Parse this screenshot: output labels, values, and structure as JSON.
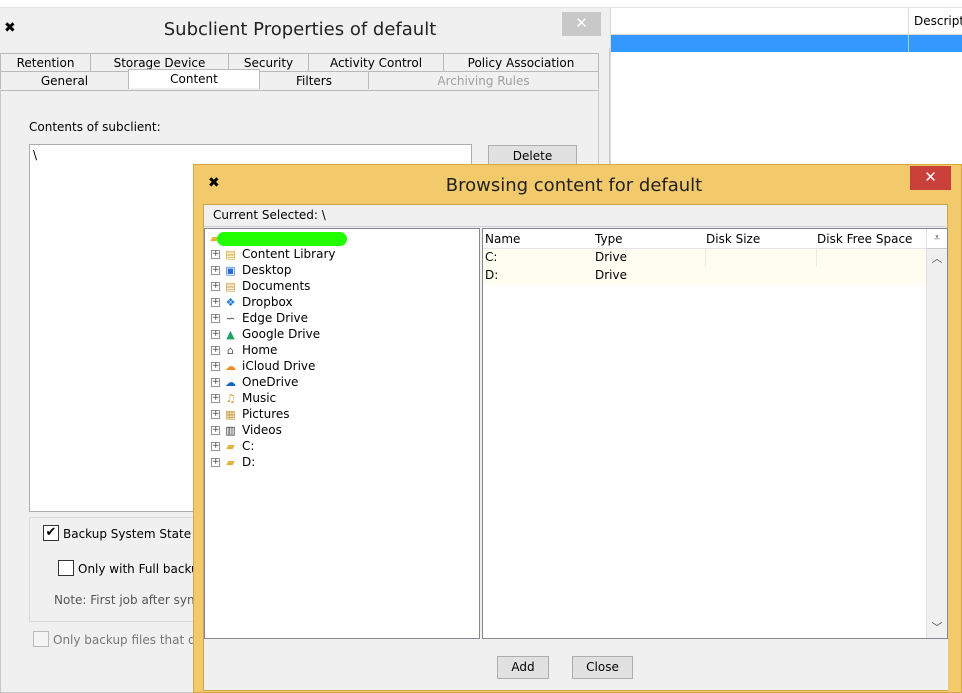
{
  "background_window": {
    "column_header": "Descripti"
  },
  "subclient_dialog": {
    "title": "Subclient Properties of default",
    "close_glyph": "✕",
    "tabs_row1": [
      "Retention",
      "Storage Device",
      "Security",
      "Activity Control",
      "Policy Association"
    ],
    "tabs_row2": [
      "General",
      "Content",
      "Filters",
      "Archiving Rules"
    ],
    "active_tab": "Content",
    "contents_label": "Contents of subclient:",
    "content_items": [
      "\\"
    ],
    "delete_button": "Delete",
    "backup_system_state_label": "Backup System State",
    "backup_system_state_checked": true,
    "only_full_backup_label": "Only with Full backu",
    "only_full_backup_checked": false,
    "note_text": "Note: First job after synt",
    "only_backup_files_label": "Only backup files that qu",
    "only_backup_files_checked": false
  },
  "browse_dialog": {
    "title": "Browsing content for default",
    "close_glyph": "✕",
    "current_selected": "Current Selected: \\",
    "tree_items": [
      {
        "label": "Content Library",
        "icon": "content-library-icon"
      },
      {
        "label": "Desktop",
        "icon": "desktop-icon"
      },
      {
        "label": "Documents",
        "icon": "documents-icon"
      },
      {
        "label": "Dropbox",
        "icon": "dropbox-icon"
      },
      {
        "label": "Edge Drive",
        "icon": "edge-drive-icon"
      },
      {
        "label": "Google Drive",
        "icon": "google-drive-icon"
      },
      {
        "label": "Home",
        "icon": "home-icon"
      },
      {
        "label": "iCloud Drive",
        "icon": "icloud-drive-icon"
      },
      {
        "label": "OneDrive",
        "icon": "onedrive-icon"
      },
      {
        "label": "Music",
        "icon": "music-icon"
      },
      {
        "label": "Pictures",
        "icon": "pictures-icon"
      },
      {
        "label": "Videos",
        "icon": "videos-icon"
      },
      {
        "label": "C:",
        "icon": "folder-icon"
      },
      {
        "label": "D:",
        "icon": "folder-icon"
      }
    ],
    "grid_headers": [
      "Name",
      "Type",
      "Disk Size",
      "Disk Free Space"
    ],
    "grid_rows": [
      {
        "name": "C:",
        "type": "Drive",
        "disk_size": "",
        "disk_free": ""
      },
      {
        "name": "D:",
        "type": "Drive",
        "disk_size": "",
        "disk_free": ""
      }
    ],
    "add_button": "Add",
    "close_button": "Close"
  },
  "colors": {
    "selection_blue": "#3399ff",
    "browse_frame": "#f2c96b",
    "close_red": "#c9403a",
    "redaction_green": "#21ff00"
  }
}
